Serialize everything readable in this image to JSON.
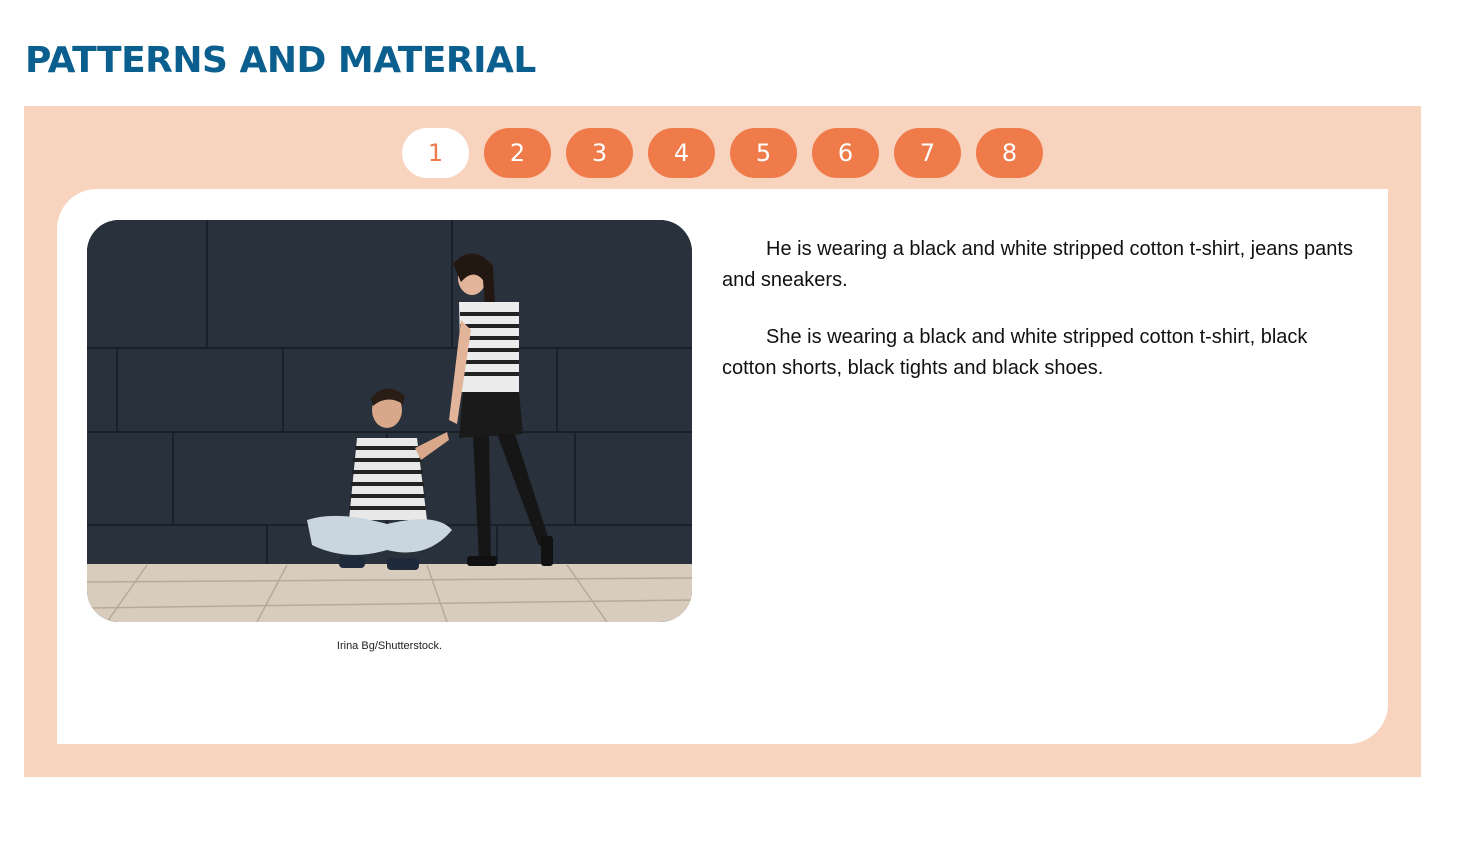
{
  "page": {
    "title": "PATTERNS AND MATERIAL"
  },
  "tabs": [
    {
      "label": "1",
      "active": true
    },
    {
      "label": "2",
      "active": false
    },
    {
      "label": "3",
      "active": false
    },
    {
      "label": "4",
      "active": false
    },
    {
      "label": "5",
      "active": false
    },
    {
      "label": "6",
      "active": false
    },
    {
      "label": "7",
      "active": false
    },
    {
      "label": "8",
      "active": false
    }
  ],
  "slide": {
    "credit": "Irina Bg/Shutterstock.",
    "paragraphs": [
      "He is wearing a black and white stripped cotton t-shirt, jeans pants and sneakers.",
      "She is wearing a black and white stripped cotton t-shirt, black cotton shorts, black tights and black shoes."
    ]
  },
  "colors": {
    "title": "#0b5f8f",
    "panel_bg": "#f8d4bf",
    "tab_bg": "#ef7b4b",
    "tab_active_bg": "#ffffff"
  }
}
